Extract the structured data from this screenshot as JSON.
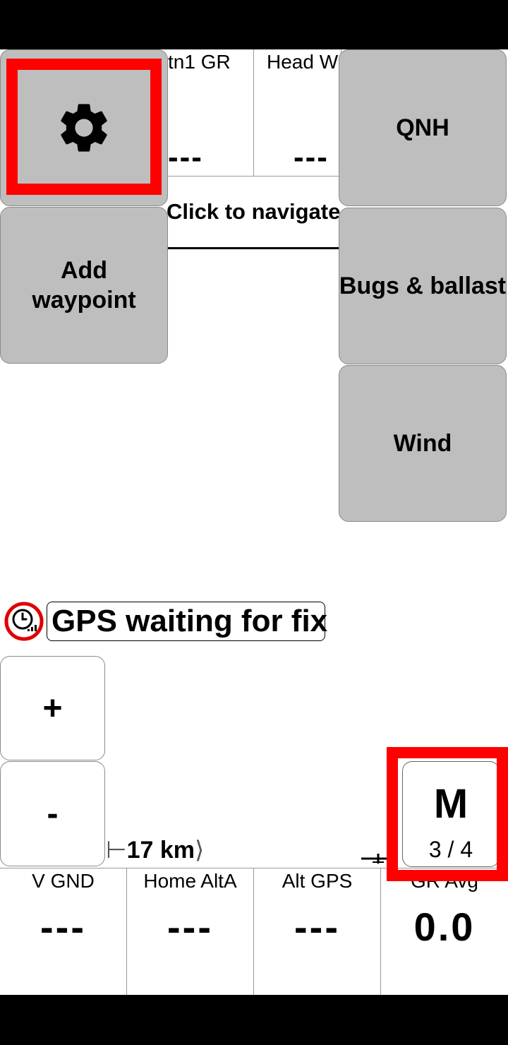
{
  "top_infoboxes": [
    {
      "title": "tn1 GR",
      "value": "---"
    },
    {
      "title": "Head W",
      "value": "---"
    }
  ],
  "menu": {
    "settings_icon": "gear-icon",
    "add_waypoint": "Add waypoint",
    "qnh": "QNH",
    "bugs_ballast": "Bugs & ballast",
    "wind": "Wind"
  },
  "nav_prompt": "Click to navigate",
  "gps": {
    "icon": "clock-signal-icon",
    "status": "GPS waiting for fix"
  },
  "zoom": {
    "in_label": "+",
    "out_label": "-"
  },
  "scale": {
    "text": "17 km"
  },
  "mode_button": {
    "letter": "M",
    "page": "3 / 4"
  },
  "bottom_infoboxes": [
    {
      "title": "V GND",
      "value": "---"
    },
    {
      "title": "Home AltA",
      "value": "---"
    },
    {
      "title": "Alt GPS",
      "value": "---"
    },
    {
      "title": "GR Avg",
      "value": "0.0"
    }
  ],
  "colors": {
    "button_grey": "#bebebe",
    "highlight_red": "#ff0000",
    "gps_warning_red": "#e00000"
  }
}
